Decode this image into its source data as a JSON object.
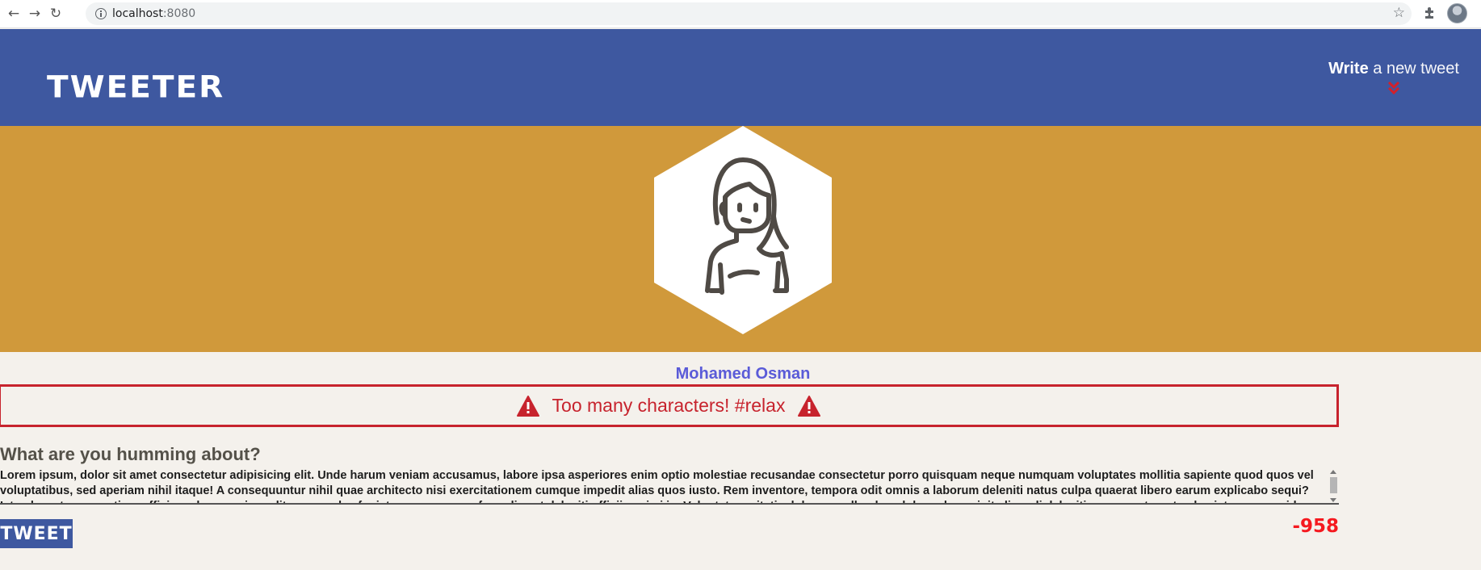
{
  "browser": {
    "url_host": "localhost",
    "url_port": ":8080",
    "back_icon": "back-arrow-icon",
    "forward_icon": "forward-arrow-icon",
    "reload_icon": "reload-icon"
  },
  "nav": {
    "logo": "TWEETER",
    "compose_bold": "Write",
    "compose_rest": " a new tweet"
  },
  "profile": {
    "name": "Mohamed Osman"
  },
  "error": {
    "message": "Too many characters! #relax"
  },
  "composer": {
    "prompt": "What are you humming about?",
    "text": "Lorem ipsum, dolor sit amet consectetur adipisicing elit. Unde harum veniam accusamus, labore ipsa asperiores enim optio molestiae recusandae consectetur porro quisquam neque numquam voluptates mollitia sapiente quod quos vel voluptatibus, sed aperiam nihil itaque! A consequuntur nihil quae architecto nisi exercitationem cumque impedit alias quos iusto. Rem inventore, tempora odit omnis a laborum deleniti natus culpa quaerat libero earum explicabo sequi? Iste placeat accusantium officia, culpa, rem impedit recusandae fugiat accusamus perferendis est deleniti officiis animi in. Voluptate veritatis dolore repellendus, dolor vel suscipit eligendi deleniti consequatur, ut culpa iste quam quidem",
    "button_label": "TWEET",
    "counter": "-958"
  },
  "colors": {
    "nav_bg": "#3e58a0",
    "hero_bg": "#d0993b",
    "page_bg": "#f4f1ec",
    "error": "#c7232d",
    "counter": "#f5191f",
    "username": "#5a5bd8"
  }
}
